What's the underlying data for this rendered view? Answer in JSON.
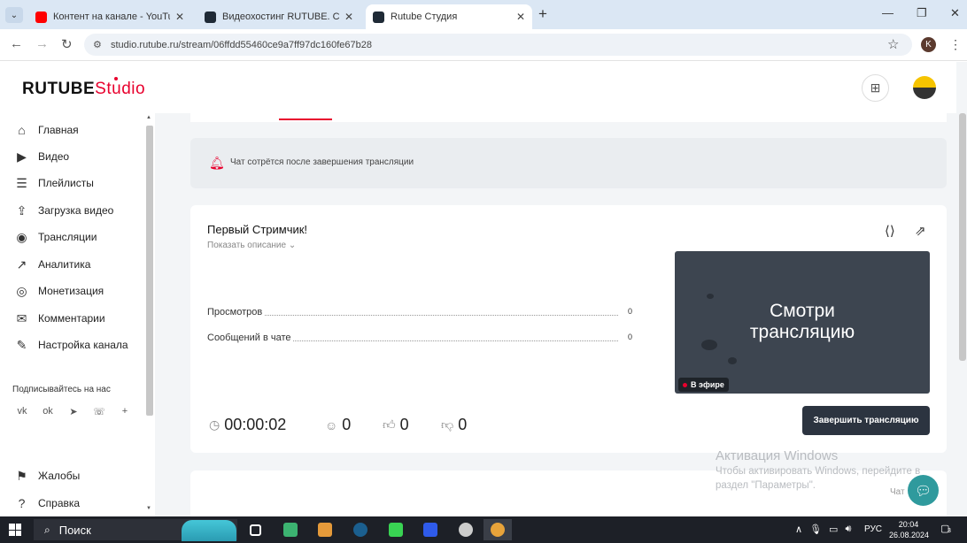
{
  "browser": {
    "tabs": [
      {
        "title": "Контент на канале - YouTube Studio",
        "icon_color": "#ff0000",
        "active": false
      },
      {
        "title": "Видеохостинг RUTUBE. Смотрите",
        "icon_color": "#1f2a36",
        "active": false
      },
      {
        "title": "Rutube Студия",
        "icon_color": "#1f2a36",
        "active": true
      }
    ],
    "tab_close": "✕",
    "new_tab": "+",
    "url": "studio.rutube.ru/stream/06ffdd55460ce9a7ff97dc160fe67b28",
    "profile_initial": "K"
  },
  "header": {
    "logo_main": "RUTUBE",
    "logo_studio": "Studio"
  },
  "sidebar": {
    "items": [
      {
        "label": "Главная",
        "icon": "home-icon",
        "glyph": "⌂"
      },
      {
        "label": "Видео",
        "icon": "video-icon",
        "glyph": "▶"
      },
      {
        "label": "Плейлисты",
        "icon": "playlist-icon",
        "glyph": "☰"
      },
      {
        "label": "Загрузка видео",
        "icon": "upload-icon",
        "glyph": "⇪"
      },
      {
        "label": "Трансляции",
        "icon": "broadcast-icon",
        "glyph": "◉"
      },
      {
        "label": "Аналитика",
        "icon": "analytics-icon",
        "glyph": "↗"
      },
      {
        "label": "Монетизация",
        "icon": "monetization-icon",
        "glyph": "◎"
      },
      {
        "label": "Комментарии",
        "icon": "comments-icon",
        "glyph": "✉"
      },
      {
        "label": "Настройка канала",
        "icon": "settings-wand-icon",
        "glyph": "✎"
      }
    ],
    "subscribe_title": "Подписывайтесь на нас",
    "socials": [
      {
        "name": "vk-icon",
        "glyph": "vk"
      },
      {
        "name": "odnoklassniki-icon",
        "glyph": "ok"
      },
      {
        "name": "telegram-icon",
        "glyph": "➤"
      },
      {
        "name": "viber-icon",
        "glyph": "☏"
      },
      {
        "name": "more-icon",
        "glyph": "+"
      }
    ],
    "bottom_items": [
      {
        "label": "Жалобы",
        "icon": "complaint-flag-icon",
        "glyph": "⚑"
      },
      {
        "label": "Справка",
        "icon": "help-icon",
        "glyph": "?"
      }
    ]
  },
  "notice": {
    "text": "Чат сотрётся после завершения трансляции"
  },
  "stream": {
    "title": "Первый Стримчик!",
    "show_description": "Показать описание",
    "stats": [
      {
        "label": "Просмотров",
        "value": "0"
      },
      {
        "label": "Сообщений в чате",
        "value": "0"
      }
    ],
    "preview_text_line1": "Смотри",
    "preview_text_line2": "трансляцию",
    "live_badge": "В эфире",
    "timer": "00:00:02",
    "viewers": "0",
    "likes": "0",
    "dislikes": "0",
    "end_button": "Завершить трансляцию"
  },
  "watermark": {
    "title": "Активация Windows",
    "line1": "Чтобы активировать Windows, перейдите в",
    "line2": "раздел \"Параметры\"."
  },
  "chat_label": "Чат",
  "taskbar": {
    "search": "Поиск",
    "lang": "РУС",
    "time": "20:04",
    "date": "26.08.2024",
    "notifications": "3",
    "apps": [
      {
        "name": "task-view-icon",
        "color": "#ffffff"
      },
      {
        "name": "app-green-icon",
        "color": "#3cb371"
      },
      {
        "name": "app-orange-icon",
        "color": "#e59a3a"
      },
      {
        "name": "steam-icon",
        "color": "#1b5f8f"
      },
      {
        "name": "app-lime-icon",
        "color": "#39d353"
      },
      {
        "name": "app-blue-icon",
        "color": "#2f5bea"
      },
      {
        "name": "obs-icon",
        "color": "#cccccc"
      },
      {
        "name": "chrome-icon",
        "color": "#e8a33a"
      }
    ]
  },
  "colors": {
    "accent_red": "#e8002d",
    "button_dark": "#2c3440",
    "chat_fab": "#2f9a9d"
  }
}
